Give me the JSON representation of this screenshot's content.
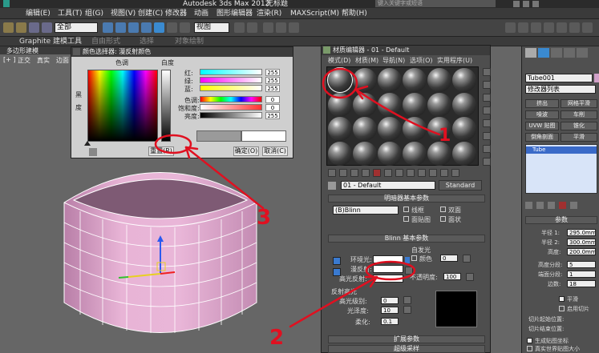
{
  "app": {
    "title_prefix": "Autodesk 3ds Max  2012",
    "title_file": "无标题",
    "search_placeholder": "键入关键字或短语",
    "menu": [
      "编辑(E)",
      "工具(T)",
      "组(G)",
      "视图(V)",
      "创建(C)",
      "修改器",
      "动画",
      "图形编辑器",
      "渲染(R)",
      "MAXScript(M)",
      "帮助(H)"
    ],
    "toolbar": {
      "selection_set": "全部",
      "view": "视图"
    },
    "ribbon_tabs": [
      "Graphite 建模工具",
      "自由形式",
      "选择",
      "对象绘制"
    ],
    "ribbon_sub": "多边形建模"
  },
  "viewport": {
    "labels": [
      "[+ ]",
      "正交",
      "真实",
      "边面"
    ]
  },
  "color_dialog": {
    "title": "颜色选择器: 漫反射颜色",
    "hue_label": "色调",
    "whiteness_label": "白度",
    "blackness_label": "黑",
    "blackness_label2": "度",
    "channels": [
      {
        "label": "红:",
        "value": "255"
      },
      {
        "label": "绿:",
        "value": "255"
      },
      {
        "label": "蓝:",
        "value": "255"
      },
      {
        "label": "色调:",
        "value": "0"
      },
      {
        "label": "饱和度:",
        "value": "0"
      },
      {
        "label": "亮度:",
        "value": "255"
      }
    ],
    "reset_label": "重置(R)",
    "ok_label": "确定(O)",
    "cancel_label": "取消(C)"
  },
  "material_editor": {
    "title": "材质编辑器 - 01 - Default",
    "menu": [
      "模式(D)",
      "材质(M)",
      "导航(N)",
      "选项(O)",
      "实用程序(U)"
    ],
    "material_name": "01 - Default",
    "material_type": "Standard",
    "shader_rollout": "明暗器基本参数",
    "shader": "(B)Blinn",
    "shader_options": [
      "线框",
      "双面",
      "面贴图",
      "面状"
    ],
    "blinn_rollout": "Blinn 基本参数",
    "self_illum_label": "自发光",
    "color_label": "颜色",
    "self_illum_value": "0",
    "ambient_label": "环境光:",
    "diffuse_label": "漫反射:",
    "specular_label": "高光反射:",
    "opacity_label": "不透明度:",
    "opacity_value": "100",
    "highlights_label": "反射高光",
    "spec_level_label": "高光级别:",
    "spec_level_value": "0",
    "gloss_label": "光泽度:",
    "gloss_value": "10",
    "soften_label": "柔化:",
    "soften_value": "0.1",
    "extended_rollout": "扩展参数",
    "supersampling_rollout": "超级采样"
  },
  "command_panel": {
    "object_name": "Tube001",
    "modifier_list": "修改器列表",
    "buttons": [
      "挤出",
      "网格平滑",
      "噪波",
      "车削",
      "UVW 贴图",
      "锥化",
      "倒角剖面",
      "平滑"
    ],
    "stack_item": "Tube",
    "params_title": "参数",
    "params": [
      {
        "label": "半径 1:",
        "value": "295.0mm"
      },
      {
        "label": "半径 2:",
        "value": "300.0mm"
      },
      {
        "label": "高度:",
        "value": "200.0mm"
      },
      {
        "label": "高度分段:",
        "value": "5"
      },
      {
        "label": "端面分段:",
        "value": "1"
      },
      {
        "label": "边数:",
        "value": "18"
      }
    ],
    "smooth_label": "平滑",
    "slice_label": "启用切片",
    "slice_from_label": "切片起始位置:",
    "slice_to_label": "切片结束位置:",
    "map_coords_label": "生成贴图坐标",
    "real_world_label": "真实世界贴图大小"
  },
  "annotations": [
    "1",
    "2",
    "3"
  ],
  "colors": {
    "tube": "#e3a8cf",
    "annotation": "#e01020"
  }
}
